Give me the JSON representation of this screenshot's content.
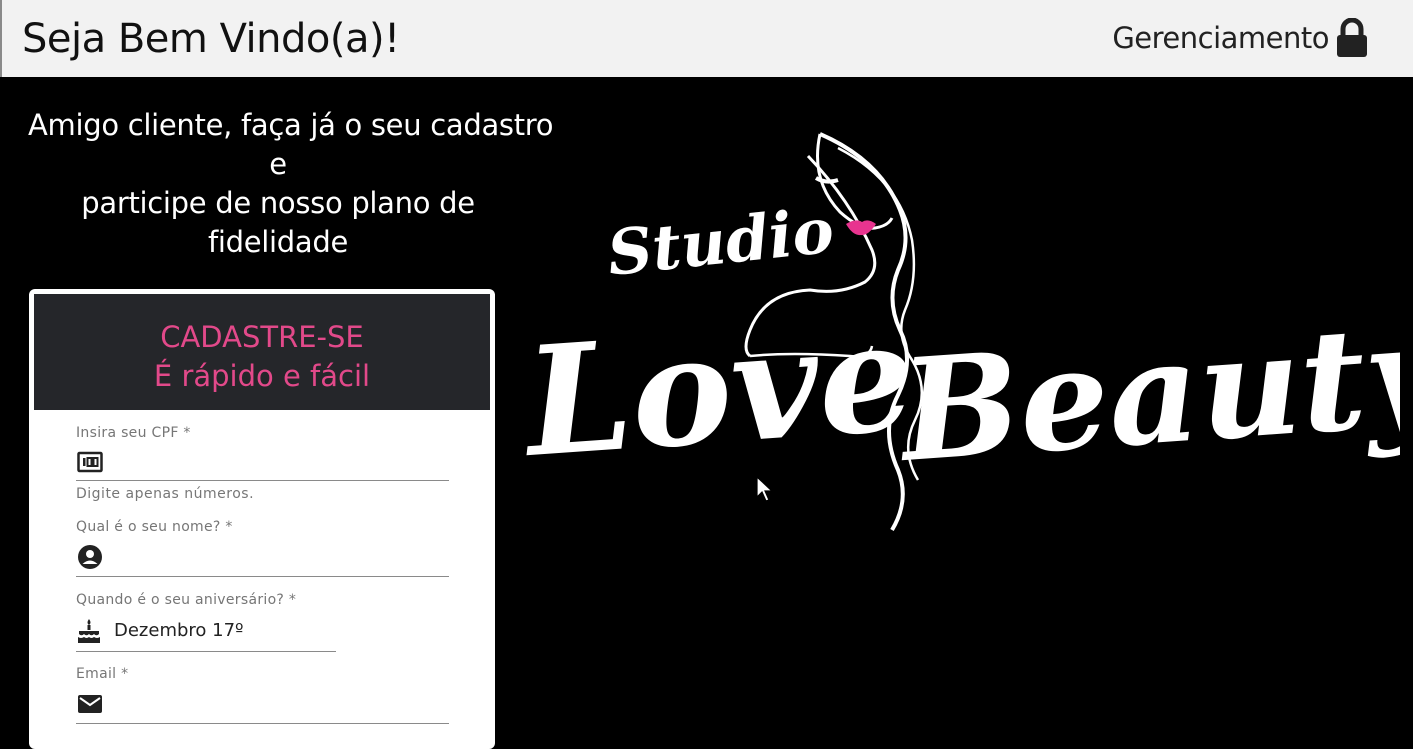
{
  "header": {
    "title": "Seja Bem Vindo(a)!",
    "management_label": "Gerenciamento",
    "management_icon": "lock-icon"
  },
  "promo": {
    "line1": "Amigo cliente, faça já o seu cadastro",
    "line2": "e",
    "line3": "participe de nosso plano de",
    "line4": "fidelidade"
  },
  "card": {
    "title": "CADASTRE-SE",
    "subtitle": "É rápido e fácil",
    "accent_color": "#e2498a",
    "header_bg": "#25262a"
  },
  "form": {
    "cpf": {
      "label": "Insira seu CPF *",
      "value": "",
      "hint": "Digite apenas números.",
      "icon": "id-card-icon"
    },
    "name": {
      "label": "Qual é o seu nome? *",
      "value": "",
      "icon": "account-circle-icon"
    },
    "birthday": {
      "label": "Quando é o seu aniversário? *",
      "value": "Dezembro 17º",
      "icon": "cake-icon"
    },
    "email": {
      "label": "Email *",
      "value": "",
      "icon": "mail-icon"
    }
  },
  "logo": {
    "word1": "Studio",
    "word2": "Love",
    "word3": "Beauty",
    "lip_color": "#e8348f"
  }
}
